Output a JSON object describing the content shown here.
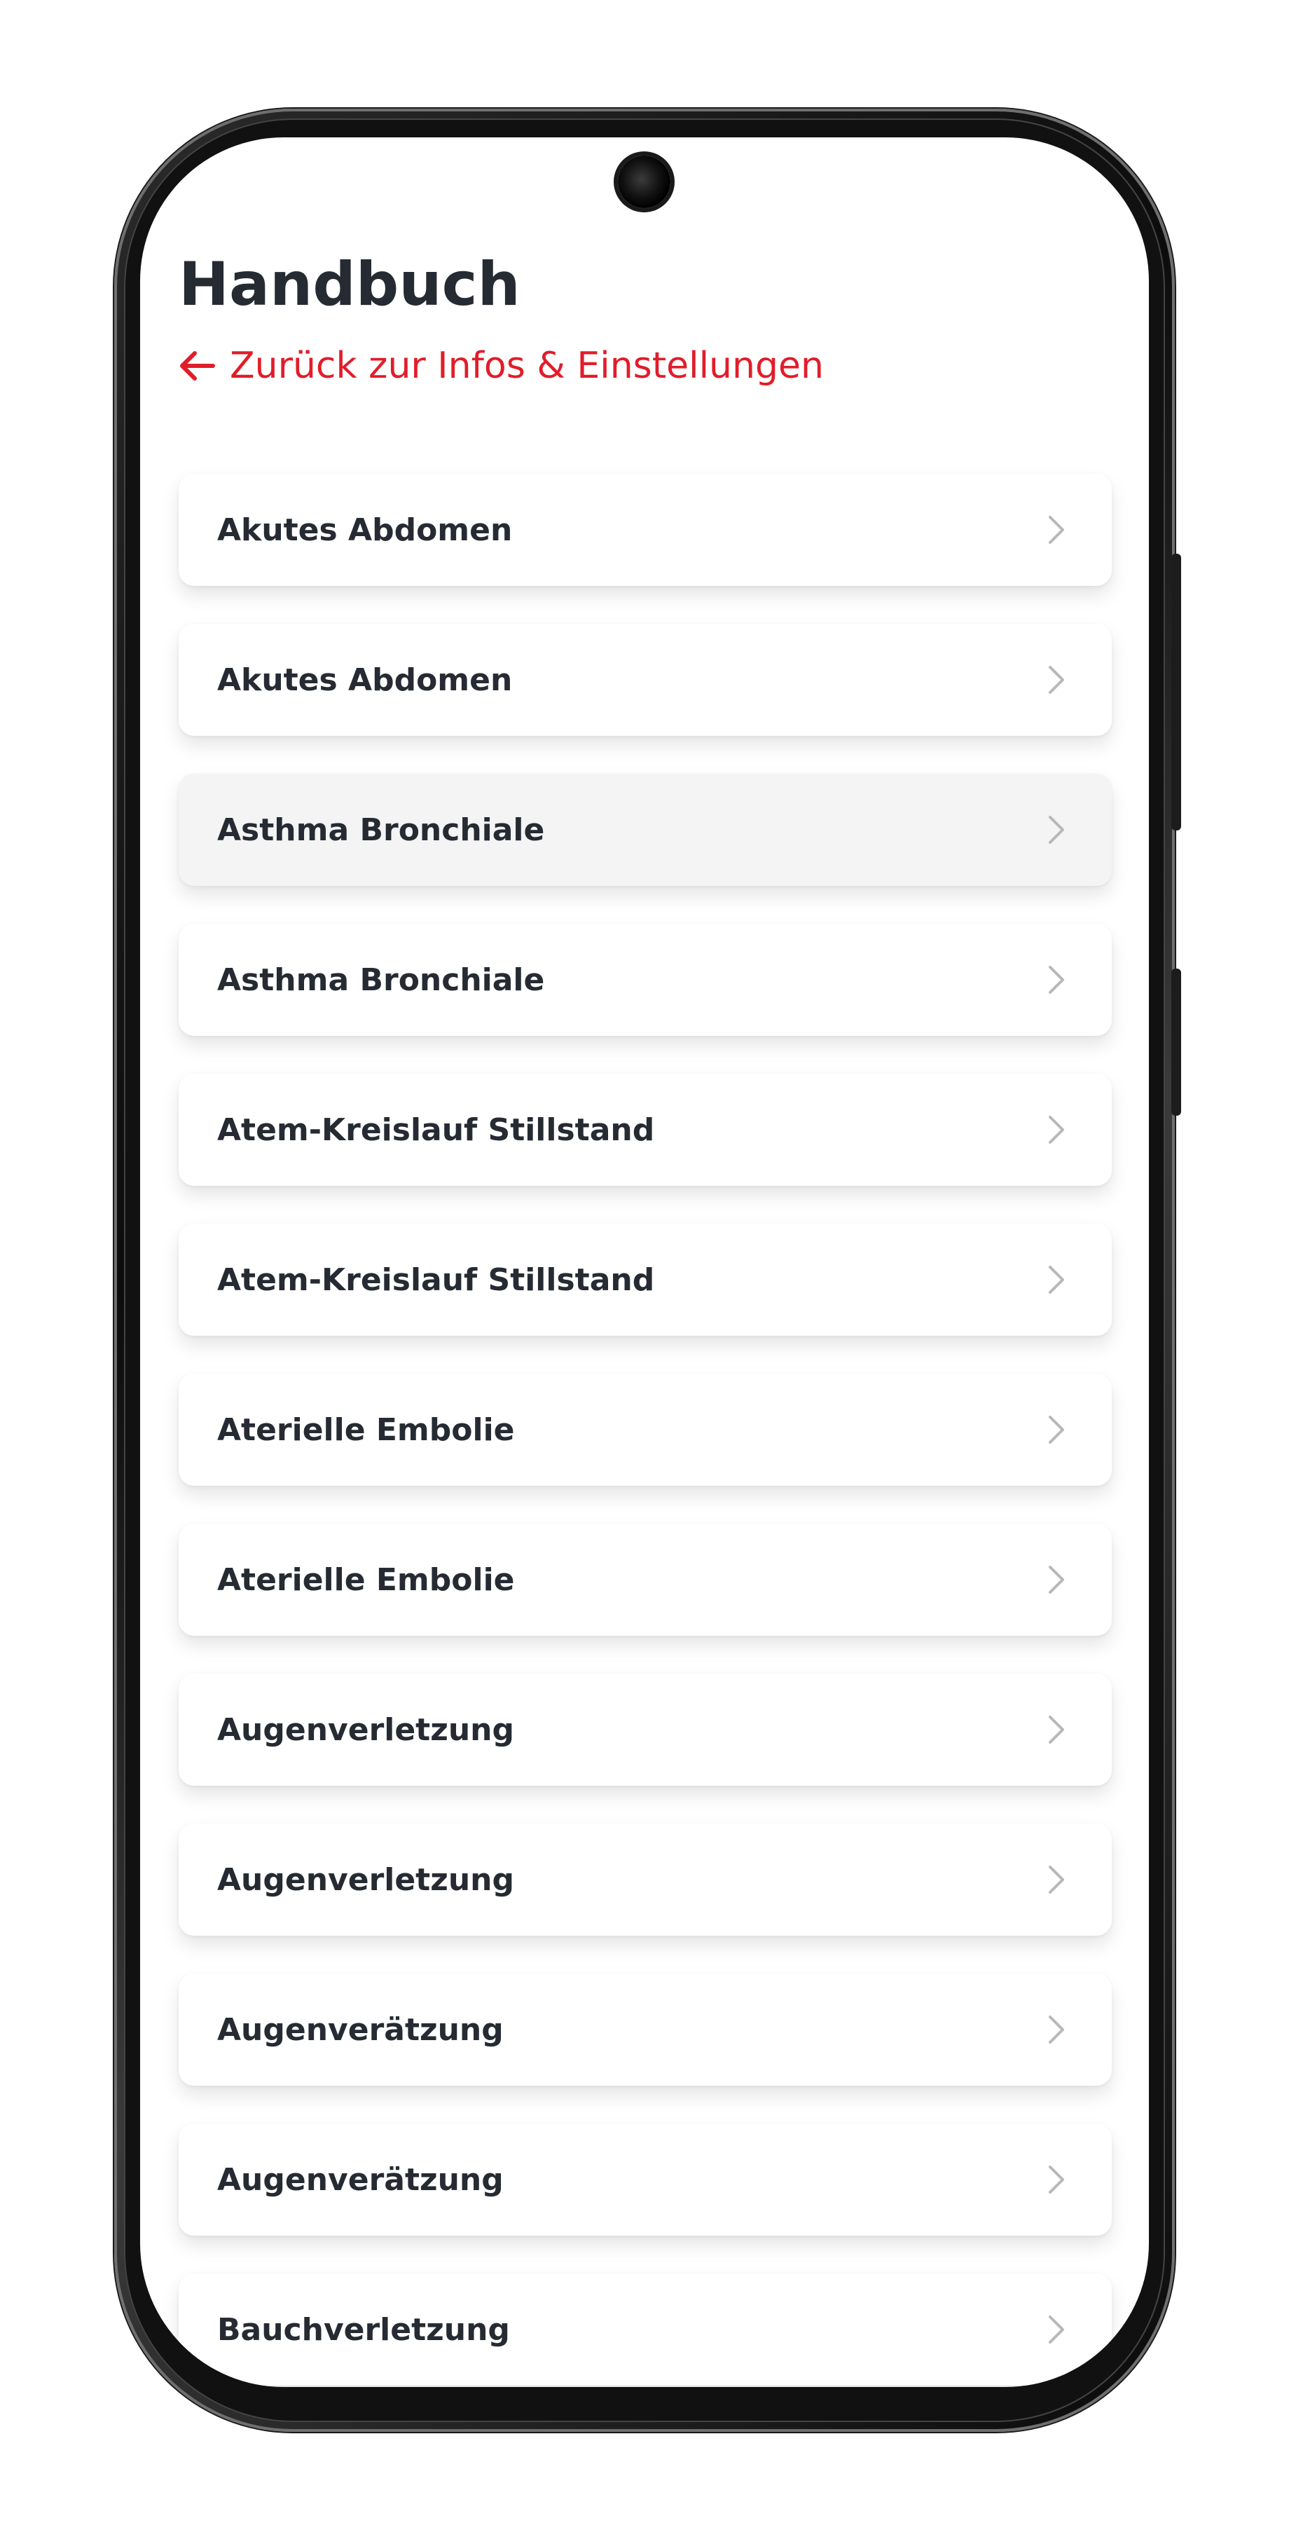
{
  "header": {
    "title": "Handbuch",
    "back_label": "Zurück zur Infos & Einstellungen"
  },
  "icons": {
    "back": "arrow-left-icon",
    "item": "chevron-right-icon"
  },
  "colors": {
    "accent": "#e11d2a",
    "text": "#262b33",
    "card": "#ffffff",
    "card_pressed": "#f4f4f4",
    "chevron": "#b8b8b8"
  },
  "items": [
    {
      "label": "Akutes Abdomen"
    },
    {
      "label": "Akutes Abdomen"
    },
    {
      "label": "Asthma Bronchiale",
      "pressed": true
    },
    {
      "label": "Asthma Bronchiale"
    },
    {
      "label": "Atem-Kreislauf Stillstand"
    },
    {
      "label": "Atem-Kreislauf Stillstand"
    },
    {
      "label": "Aterielle Embolie"
    },
    {
      "label": "Aterielle Embolie"
    },
    {
      "label": "Augenverletzung"
    },
    {
      "label": "Augenverletzung"
    },
    {
      "label": "Augenverätzung"
    },
    {
      "label": "Augenverätzung"
    },
    {
      "label": "Bauchverletzung"
    }
  ]
}
